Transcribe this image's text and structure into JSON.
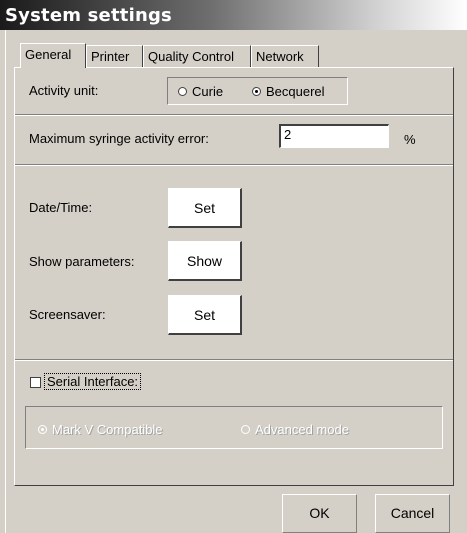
{
  "window": {
    "title": "System settings"
  },
  "tabs": [
    {
      "label": "General",
      "active": true
    },
    {
      "label": "Printer",
      "active": false
    },
    {
      "label": "Quality Control",
      "active": false
    },
    {
      "label": "Network",
      "active": false
    }
  ],
  "activity_unit": {
    "label": "Activity unit:",
    "options": [
      {
        "label": "Curie",
        "selected": false
      },
      {
        "label": "Becquerel",
        "selected": true
      }
    ]
  },
  "syringe_error": {
    "label": "Maximum syringe activity error:",
    "value": "2",
    "unit": "%"
  },
  "settings_rows": [
    {
      "label": "Date/Time:",
      "button": "Set"
    },
    {
      "label": "Show parameters:",
      "button": "Show"
    },
    {
      "label": "Screensaver:",
      "button": "Set"
    }
  ],
  "serial_interface": {
    "label": "Serial Interface:",
    "checked": false,
    "options": [
      {
        "label": "Mark V Compatible",
        "selected": true
      },
      {
        "label": "Advanced mode",
        "selected": false
      }
    ]
  },
  "dialog_buttons": {
    "ok": "OK",
    "cancel": "Cancel"
  },
  "colors": {
    "face": "#d4d0c8",
    "shadow": "#808080",
    "highlight": "#ffffff",
    "title_dark": "#1a1a1a"
  }
}
